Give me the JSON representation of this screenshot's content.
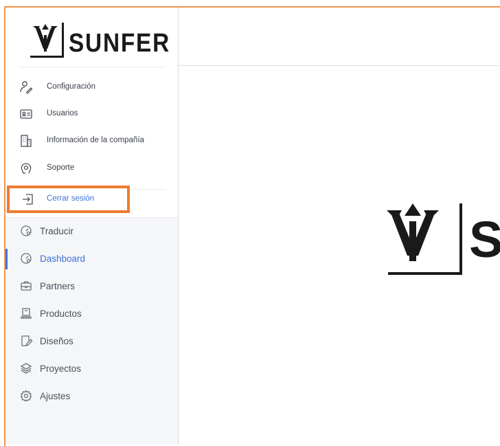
{
  "brand": {
    "name": "SUNFER"
  },
  "account_menu": {
    "items": [
      {
        "label": "Configuración",
        "icon": "user-edit-icon"
      },
      {
        "label": "Usuarios",
        "icon": "id-card-icon"
      },
      {
        "label": "Información de la compañía",
        "icon": "building-icon"
      },
      {
        "label": "Soporte",
        "icon": "support-icon"
      }
    ],
    "logout": {
      "label": "Cerrar sesión",
      "icon": "logout-icon"
    }
  },
  "nav": {
    "items": [
      {
        "label": "Traducir",
        "icon": "gauge-icon"
      },
      {
        "label": "Dashboard",
        "icon": "gauge-icon",
        "active": true
      },
      {
        "label": "Partners",
        "icon": "briefcase-icon"
      },
      {
        "label": "Productos",
        "icon": "product-icon"
      },
      {
        "label": "Diseños",
        "icon": "design-icon"
      },
      {
        "label": "Proyectos",
        "icon": "layers-icon"
      },
      {
        "label": "Ajustes",
        "icon": "gear-icon"
      }
    ]
  },
  "main": {
    "logo_text": "SUNFER"
  },
  "colors": {
    "accent": "#3f72d9",
    "highlight": "#ee7b2f",
    "text": "#3a3f4a"
  }
}
